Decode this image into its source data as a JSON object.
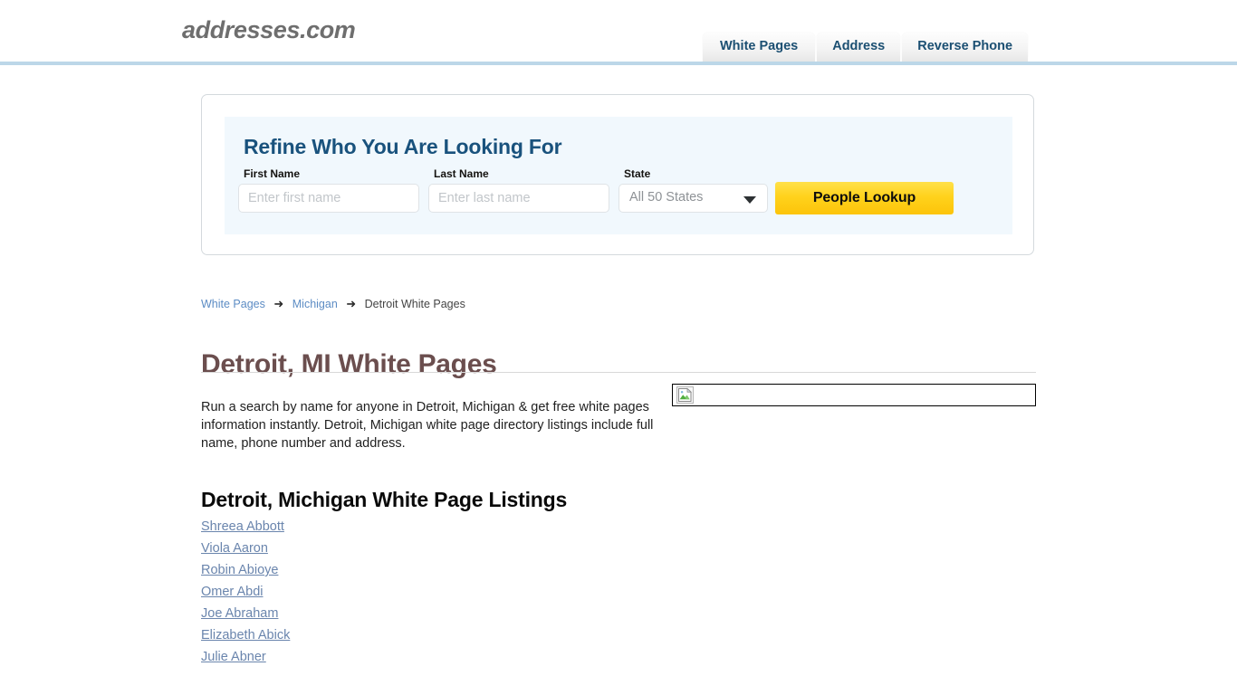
{
  "header": {
    "logo": "addresses.com",
    "tabs": [
      {
        "label": "White Pages"
      },
      {
        "label": "Address"
      },
      {
        "label": "Reverse Phone"
      }
    ],
    "rule_color": "#bcd7e8"
  },
  "search_panel": {
    "title": "Refine Who You Are Looking For",
    "first_name": {
      "label": "First Name",
      "placeholder": "Enter first name",
      "value": ""
    },
    "last_name": {
      "label": "Last Name",
      "placeholder": "Enter last name",
      "value": ""
    },
    "state": {
      "label": "State",
      "selected": "All 50 States",
      "icon": "chevron-down-icon"
    },
    "submit_label": "People Lookup",
    "submit_color": "#ffd21c",
    "panel_bg": "#f1f8fd"
  },
  "breadcrumb": {
    "items": [
      {
        "label": "White Pages",
        "link": true
      },
      {
        "label": "Michigan",
        "link": true
      },
      {
        "label": "Detroit White Pages",
        "link": false
      }
    ],
    "separator": "➜",
    "link_color": "#5c8cc4"
  },
  "main": {
    "page_title": "Detroit, MI White Pages",
    "page_title_color": "#6b4e4e",
    "intro_text": "Run a search by name for anyone in Detroit, Michigan & get free white pages information instantly. Detroit, Michigan white page directory listings include full name, phone number and address.",
    "broken_image": {
      "icon": "broken-image-icon",
      "alt": ""
    },
    "listings_heading": "Detroit, Michigan White Page Listings",
    "listings": [
      {
        "name": "Shreea Abbott"
      },
      {
        "name": "Viola Aaron"
      },
      {
        "name": "Robin Abioye"
      },
      {
        "name": "Omer Abdi"
      },
      {
        "name": "Joe Abraham"
      },
      {
        "name": "Elizabeth Abick"
      },
      {
        "name": "Julie Abner"
      }
    ],
    "listing_link_color": "#6a85ad"
  }
}
